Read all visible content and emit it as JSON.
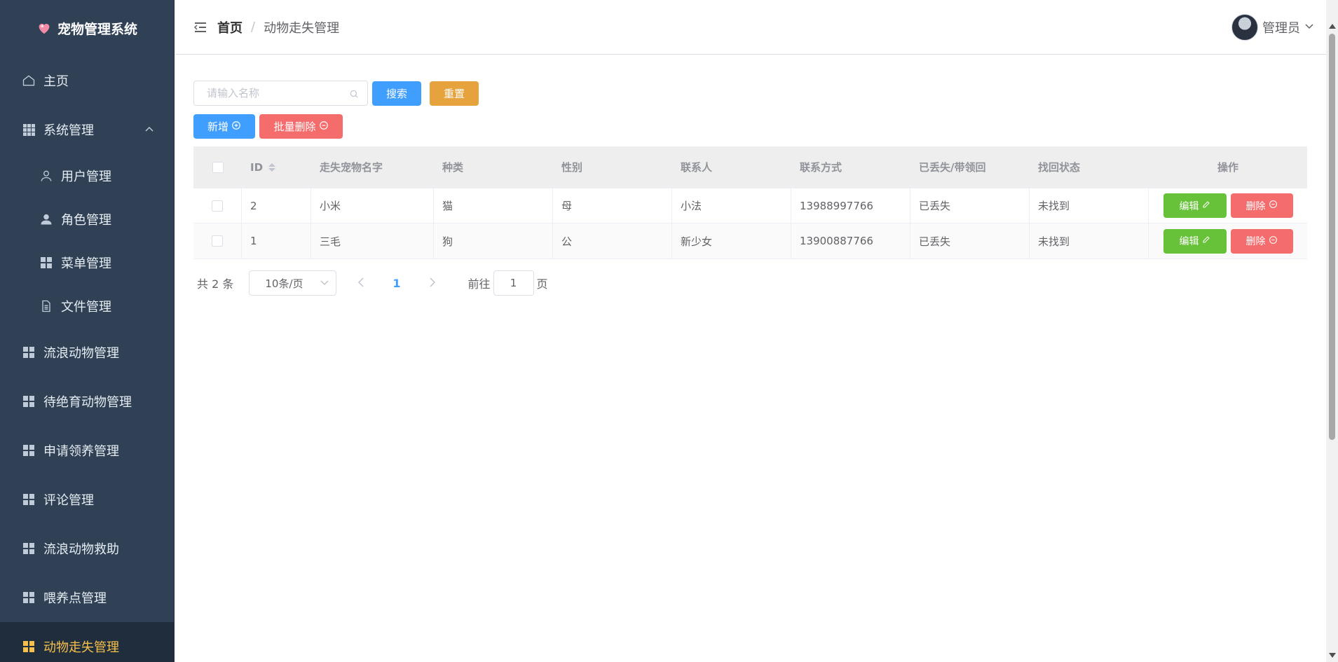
{
  "app": {
    "title": "宠物管理系统"
  },
  "sidebar": {
    "items": [
      {
        "label": "主页",
        "icon": "home-icon"
      },
      {
        "label": "系统管理",
        "icon": "grid-icon",
        "expanded": true
      },
      {
        "label": "用户管理",
        "icon": "user-icon"
      },
      {
        "label": "角色管理",
        "icon": "user-filled-icon"
      },
      {
        "label": "菜单管理",
        "icon": "menu-icon"
      },
      {
        "label": "文件管理",
        "icon": "document-icon"
      },
      {
        "label": "流浪动物管理",
        "icon": "menu-icon"
      },
      {
        "label": "待绝育动物管理",
        "icon": "menu-icon"
      },
      {
        "label": "申请领养管理",
        "icon": "menu-icon"
      },
      {
        "label": "评论管理",
        "icon": "menu-icon"
      },
      {
        "label": "流浪动物救助",
        "icon": "menu-icon"
      },
      {
        "label": "喂养点管理",
        "icon": "menu-icon"
      },
      {
        "label": "动物走失管理",
        "icon": "menu-icon",
        "active": true
      }
    ]
  },
  "header": {
    "breadcrumb_home": "首页",
    "breadcrumb_sep": "/",
    "breadcrumb_current": "动物走失管理",
    "user_name": "管理员"
  },
  "toolbar": {
    "search_placeholder": "请输入名称",
    "search_label": "搜索",
    "reset_label": "重置",
    "add_label": "新增",
    "batch_delete_label": "批量删除"
  },
  "table": {
    "columns": [
      "ID",
      "走失宠物名字",
      "种类",
      "性别",
      "联系人",
      "联系方式",
      "已丢失/带领回",
      "找回状态",
      "操作"
    ],
    "rows": [
      {
        "id": "2",
        "name": "小米",
        "kind": "猫",
        "sex": "母",
        "contact": "小法",
        "phone": "13988997766",
        "lost": "已丢失",
        "status": "未找到"
      },
      {
        "id": "1",
        "name": "三毛",
        "kind": "狗",
        "sex": "公",
        "contact": "新少女",
        "phone": "13900887766",
        "lost": "已丢失",
        "status": "未找到"
      }
    ],
    "edit_label": "编辑",
    "delete_label": "删除"
  },
  "pagination": {
    "total_text": "共 2 条",
    "page_size": "10条/页",
    "current_page": "1",
    "goto_prefix": "前往",
    "goto_value": "1",
    "goto_suffix": "页"
  },
  "colors": {
    "sidebar_bg": "#304156",
    "active_text": "#f7c04a",
    "primary": "#409eff",
    "warning": "#e6a23c",
    "danger": "#f56c6c",
    "success": "#67c23a"
  }
}
